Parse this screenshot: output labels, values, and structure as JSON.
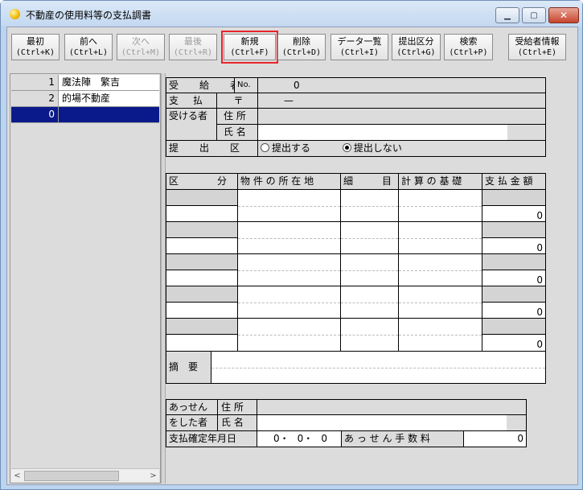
{
  "window": {
    "title": "不動産の使用料等の支払調書",
    "min": "▁",
    "max": "▢",
    "close": "✕"
  },
  "toolbar": [
    {
      "l1": "最初",
      "l2": "(Ctrl+K)",
      "disabled": false
    },
    {
      "l1": "前へ",
      "l2": "(Ctrl+L)",
      "disabled": false
    },
    {
      "l1": "次へ",
      "l2": "(Ctrl+M)",
      "disabled": true
    },
    {
      "l1": "最後",
      "l2": "(Ctrl+R)",
      "disabled": true
    },
    {
      "l1": "新規",
      "l2": "(Ctrl+F)",
      "disabled": false
    },
    {
      "l1": "削除",
      "l2": "(Ctrl+D)",
      "disabled": false
    },
    {
      "l1": "データ一覧",
      "l2": "(Ctrl+I)",
      "disabled": false
    },
    {
      "l1": "提出区分",
      "l2": "(Ctrl+G)",
      "disabled": false
    },
    {
      "l1": "検索",
      "l2": "(Ctrl+P)",
      "disabled": false
    },
    {
      "l1": "受給者情報",
      "l2": "(Ctrl+E)",
      "disabled": false
    }
  ],
  "list": [
    {
      "num": "1",
      "name": "魔法陣　繁吉"
    },
    {
      "num": "2",
      "name": "的場不動産"
    },
    {
      "num": "0",
      "name": ""
    }
  ],
  "scroll": {
    "left": "<",
    "right": ">"
  },
  "recipient": {
    "label1": "受　給　者",
    "no_label": "No.",
    "no_value": "0",
    "label2": "支 払 を",
    "postal_mark": "〒",
    "postal_value": "—",
    "label3": "受ける者",
    "addr_label": "住 所",
    "name_label": "氏 名",
    "submit_label": "提　出　区　分",
    "opt1": "提出する",
    "opt2": "提出しない"
  },
  "detail": {
    "headers": [
      "区　　　　分",
      "物 件 の 所 在 地",
      "細　　　目",
      "計 算 の 基 礎",
      "支 払 金 額"
    ],
    "amounts": [
      "0",
      "0",
      "0",
      "0",
      "0"
    ],
    "memo_label": "摘　要"
  },
  "agent": {
    "label1": "あっせん",
    "label2": "をした者",
    "addr_label": "住 所",
    "name_label": "氏 名",
    "date_label": "支払確定年月日",
    "y": "0",
    "m": "0",
    "d": "0",
    "sep": "・",
    "fee_label": "あ っ せ ん 手 数 料",
    "fee_value": "0"
  }
}
